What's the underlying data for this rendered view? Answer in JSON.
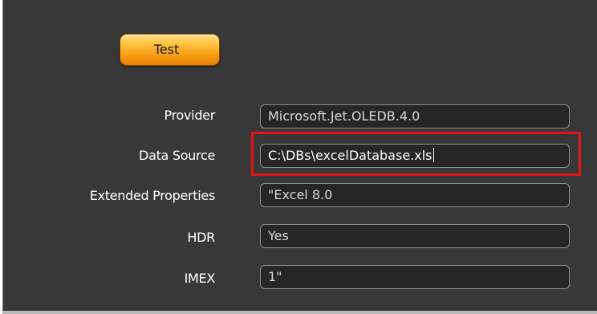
{
  "toolbar": {
    "test_label": "Test"
  },
  "form": {
    "fields": [
      {
        "label": "Provider",
        "value": "Microsoft.Jet.OLEDB.4.0"
      },
      {
        "label": "Data Source",
        "value": "C:\\DBs\\excelDatabase.xls"
      },
      {
        "label": "Extended Properties",
        "value": "\"Excel 8.0"
      },
      {
        "label": "HDR",
        "value": "Yes"
      },
      {
        "label": "IMEX",
        "value": "1\""
      }
    ]
  },
  "colors": {
    "panel_background": "#383838",
    "input_background": "#262626",
    "button_orange": "#f59a12",
    "highlight_red": "#e0151b"
  }
}
